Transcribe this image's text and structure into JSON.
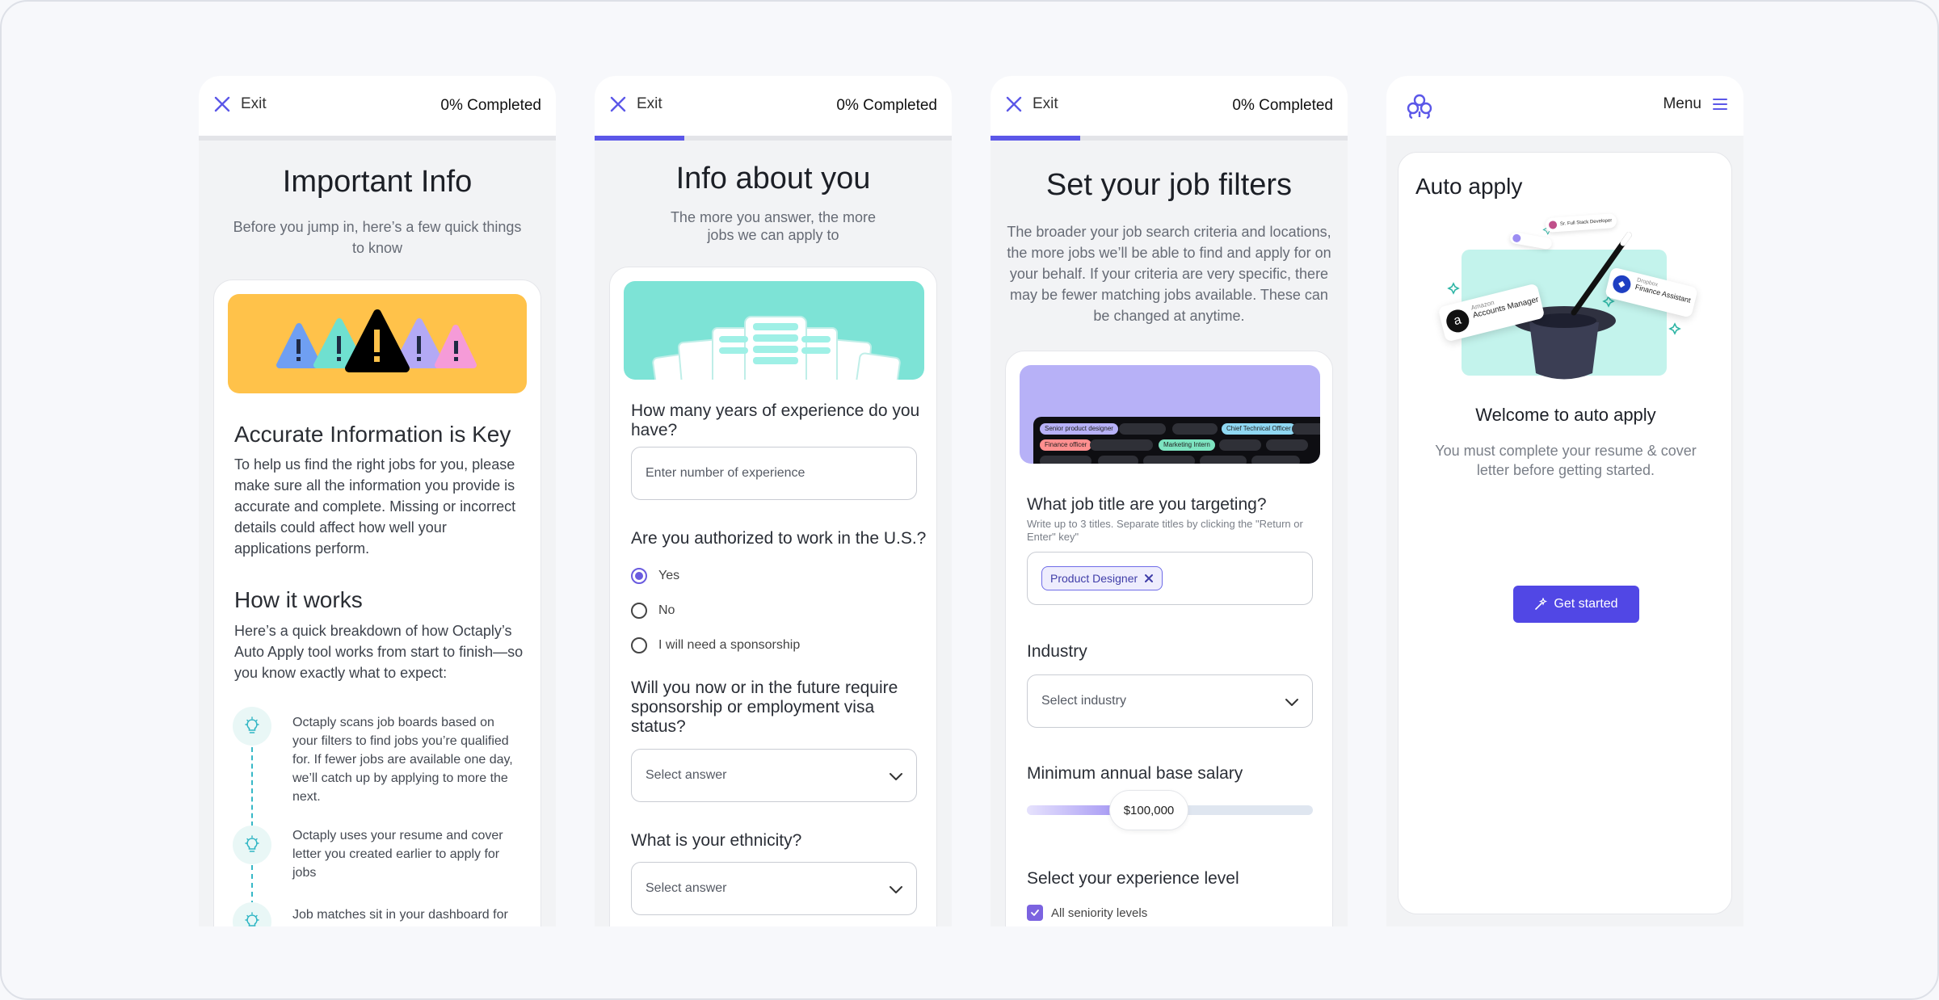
{
  "panels": [
    {
      "exit_label": "Exit",
      "progress_text": "0% Completed",
      "progress_fraction": 0,
      "title": "Important Info",
      "subtitle": "Before you jump in, here’s a few quick things to know",
      "section1_title": "Accurate Information is Key",
      "section1_body": "To help us find the right jobs for you, please make sure all the information you provide is accurate and complete. Missing or incorrect details could affect how well your applications perform.",
      "section2_title": "How it works",
      "section2_body": "Here’s a quick breakdown of how Octaply’s Auto Apply tool works from start to finish—so you know exactly what to expect:",
      "steps": [
        "Octaply scans job boards based on your filters to find jobs you’re qualified for. If fewer jobs are available one day, we’ll catch up by applying to more the next.",
        "Octaply uses your resume and cover letter you created earlier to apply for jobs",
        "Job matches sit in your dashboard for"
      ]
    },
    {
      "exit_label": "Exit",
      "progress_text": "0% Completed",
      "progress_fraction": 0.25,
      "title": "Info about you",
      "subtitle": "The more you answer, the more jobs we can apply to",
      "q1": "How many years of experience do you have?",
      "q1_placeholder": "Enter number of experience",
      "q2": "Are you authorized to work in the U.S.?",
      "q2_options": [
        "Yes",
        "No",
        "I will need a sponsorship"
      ],
      "q2_selected": "Yes",
      "q3": "Will you now or in the future require sponsorship or employment visa status?",
      "q3_value": "Select answer",
      "q4": "What is your ethnicity?",
      "q4_value": "Select answer"
    },
    {
      "exit_label": "Exit",
      "progress_text": "0% Completed",
      "progress_fraction": 0.25,
      "title": "Set your job filters",
      "subtitle": "The broader your job search criteria and locations, the more jobs we’ll be able to find and apply for on your behalf. If your criteria are very specific, there may be fewer matching jobs available. These can be changed at anytime.",
      "illustration_tags": [
        "Senior product designer",
        "Chief Technical Officer",
        "Finance officer",
        "Marketing Intern"
      ],
      "q_title": "What job title are you targeting?",
      "q_title_hint": "Write up to 3 titles. Separate titles by clicking the \"Return or Enter\" key\"",
      "chip_label": "Product Designer",
      "industry_label": "Industry",
      "industry_value": "Select industry",
      "salary_label": "Minimum annual base salary",
      "salary_value": "$100,000",
      "salary_fraction": 0.37,
      "experience_label": "Select your experience level",
      "checkbox_label": "All seniority levels",
      "checkbox_checked": true
    },
    {
      "menu_label": "Menu",
      "card_title": "Auto apply",
      "illustration_left_company": "Amazon",
      "illustration_left_role": "Accounts Manager",
      "illustration_right_company": "Dropbox",
      "illustration_right_role": "Finance Assistant",
      "illustration_top_tag": "Sr. Full Stack Developer",
      "welcome_title": "Welcome to auto apply",
      "welcome_body": "You must complete your resume & cover letter before getting started.",
      "cta_label": "Get started"
    }
  ],
  "colors": {
    "accent": "#5147e5",
    "progress": "#5b57e8",
    "mint": "#7de3d6",
    "yellow": "#ffc24a",
    "lavender": "#b7b1f7"
  }
}
